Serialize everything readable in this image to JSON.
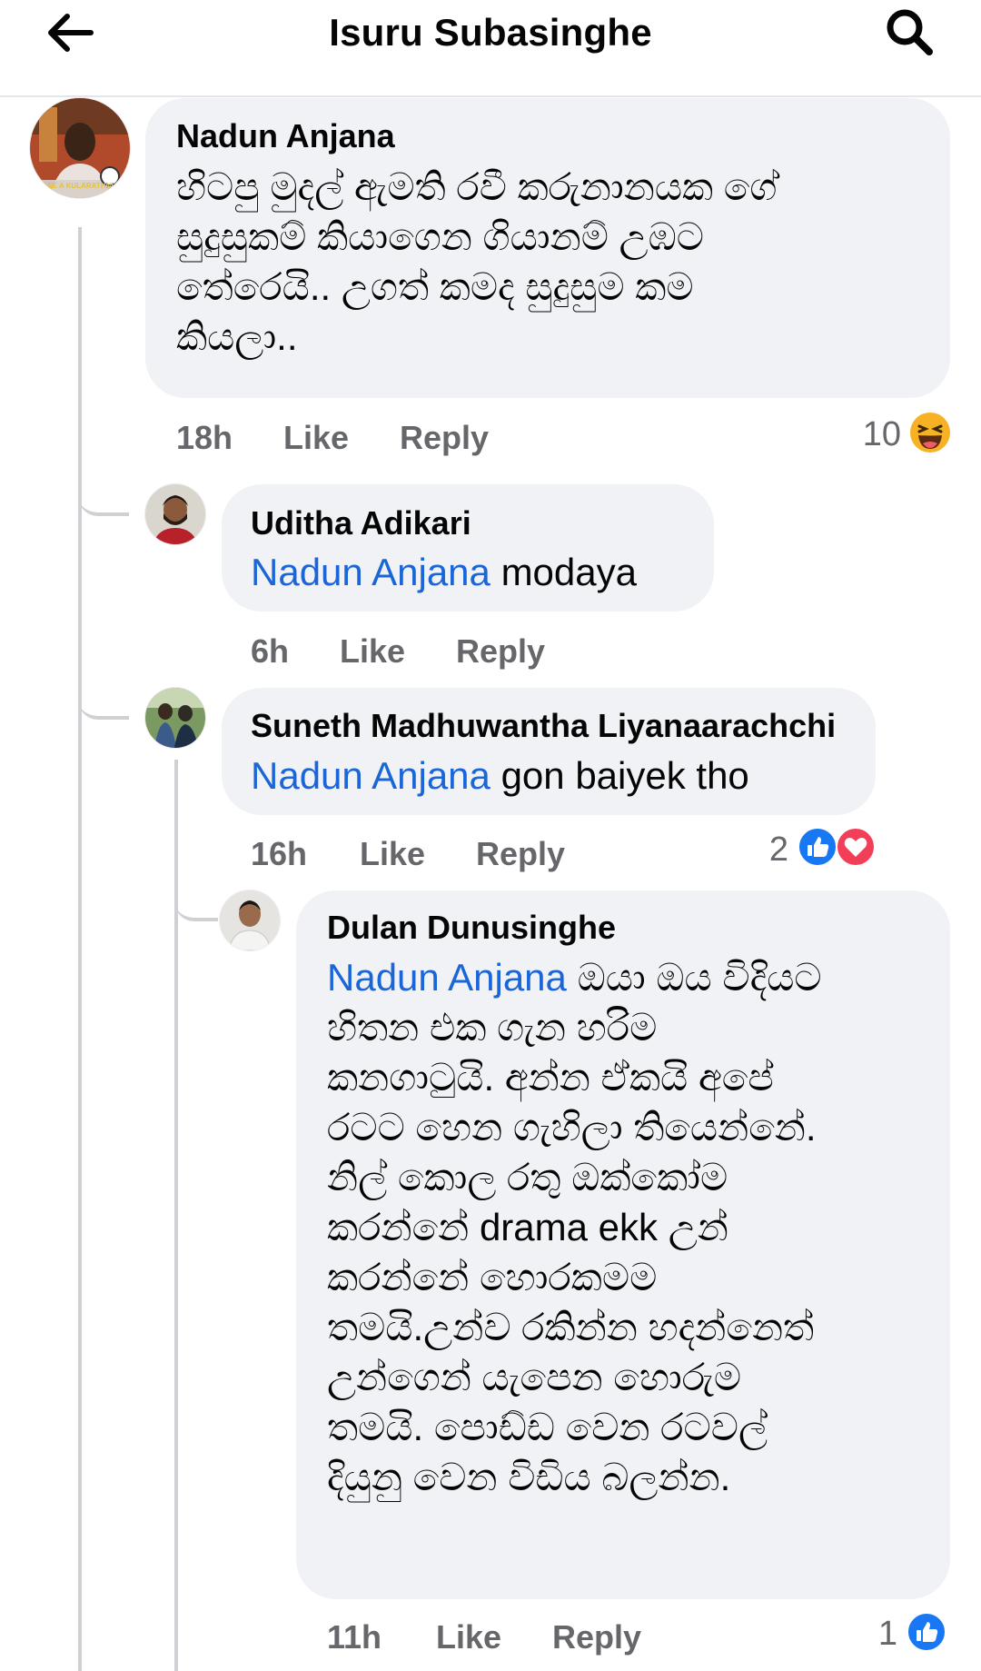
{
  "header": {
    "back_icon": "arrow-left-icon",
    "title": "Isuru Subasinghe",
    "search_icon": "search-icon"
  },
  "comments": [
    {
      "author": "Nadun Anjana",
      "mention": "",
      "lines": [
        "හිටපු මුදල් ඇමති රවී කරුනානයක ගේ",
        "සුදුසුකම් කියාගෙන ගියානම් උඹට",
        "තේරෙයි.. උගත් කමද සුදුසුම කම",
        "කියලා.."
      ],
      "time": "18h",
      "like": "Like",
      "reply": "Reply",
      "reaction_count": "10",
      "reactions": [
        "haha"
      ],
      "avatar_text": "SEE A KULARATHNE"
    },
    {
      "author": "Uditha Adikari",
      "mention": "Nadun Anjana",
      "lines": [
        " modaya"
      ],
      "time": "6h",
      "like": "Like",
      "reply": "Reply",
      "reaction_count": "",
      "reactions": []
    },
    {
      "author": "Suneth Madhuwantha Liyanaarachchi",
      "mention": "Nadun Anjana",
      "lines": [
        " gon baiyek  tho"
      ],
      "time": "16h",
      "like": "Like",
      "reply": "Reply",
      "reaction_count": "2",
      "reactions": [
        "like",
        "love"
      ]
    },
    {
      "author": "Dulan Dunusinghe",
      "mention": "Nadun Anjana",
      "lines": [
        " ඔයා ඔය විදියට",
        "හිතන එක ගැන හරිම",
        "කනගාටුයි. අන්න ඒකයි අපේ",
        "රටට හෙන ගැහිලා තියෙන්නේ.",
        "නිල් කොල රතු ඔක්කෝම",
        "කරන්නේ drama ekk උන්",
        "කරන්නේ හොරකමම",
        "තමයි.උන්ව රකින්න හදන්නෙත්",
        "උන්ගෙන් යැපෙන හොරුම",
        "තමයි. පොඩ්ඩ වෙන රටවල්",
        "දියුනු වෙන විඩිය බලන්න."
      ],
      "time": "11h",
      "like": "Like",
      "reply": "Reply",
      "reaction_count": "1",
      "reactions": [
        "like"
      ]
    }
  ],
  "colors": {
    "mention": "#1a66d8",
    "bubble": "#f0f2f5",
    "secondary_text": "#65676b",
    "like_blue": "#1877f2",
    "love_red": "#f33e58",
    "haha_yellow": "#f7b125"
  }
}
